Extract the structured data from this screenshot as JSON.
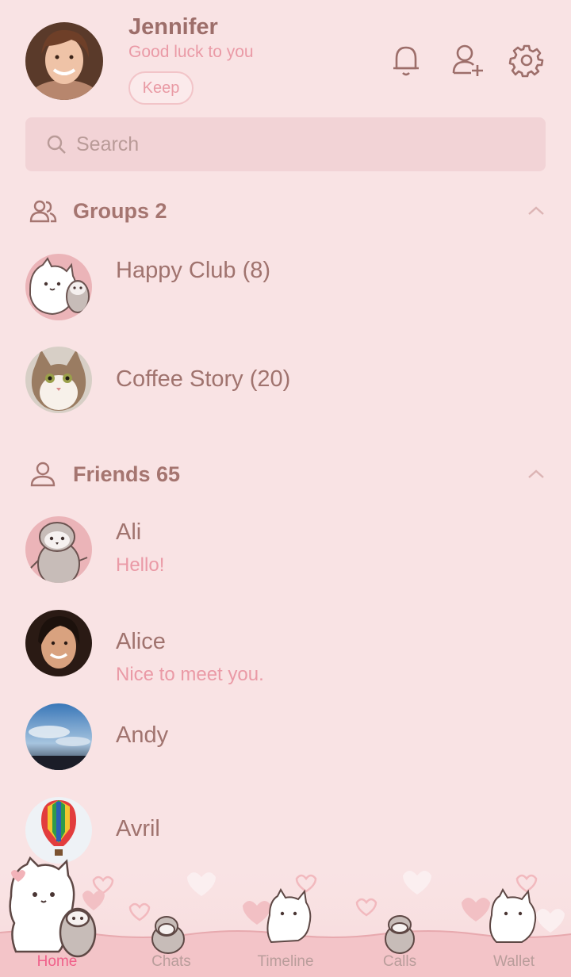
{
  "profile": {
    "name": "Jennifer",
    "status": "Good luck to you",
    "keep_label": "Keep"
  },
  "icons": {
    "bell": "bell-icon",
    "add_friend": "add-friend-icon",
    "settings": "gear-icon"
  },
  "search": {
    "placeholder": "Search"
  },
  "groups": {
    "title": "Groups 2",
    "items": [
      {
        "name": "Happy Club (8)"
      },
      {
        "name": "Coffee Story (20)"
      }
    ]
  },
  "friends": {
    "title": "Friends 65",
    "items": [
      {
        "name": "Ali",
        "message": "Hello!"
      },
      {
        "name": "Alice",
        "message": "Nice to meet you."
      },
      {
        "name": "Andy",
        "message": ""
      },
      {
        "name": "Avril",
        "message": ""
      }
    ]
  },
  "tabs": [
    {
      "label": "Home",
      "active": true
    },
    {
      "label": "Chats",
      "active": false
    },
    {
      "label": "Timeline",
      "active": false
    },
    {
      "label": "Calls",
      "active": false
    },
    {
      "label": "Wallet",
      "active": false
    }
  ],
  "colors": {
    "background": "#f9e3e4",
    "accent": "#f0608a",
    "text": "#9d6e6a",
    "status": "#ea9aa6"
  }
}
